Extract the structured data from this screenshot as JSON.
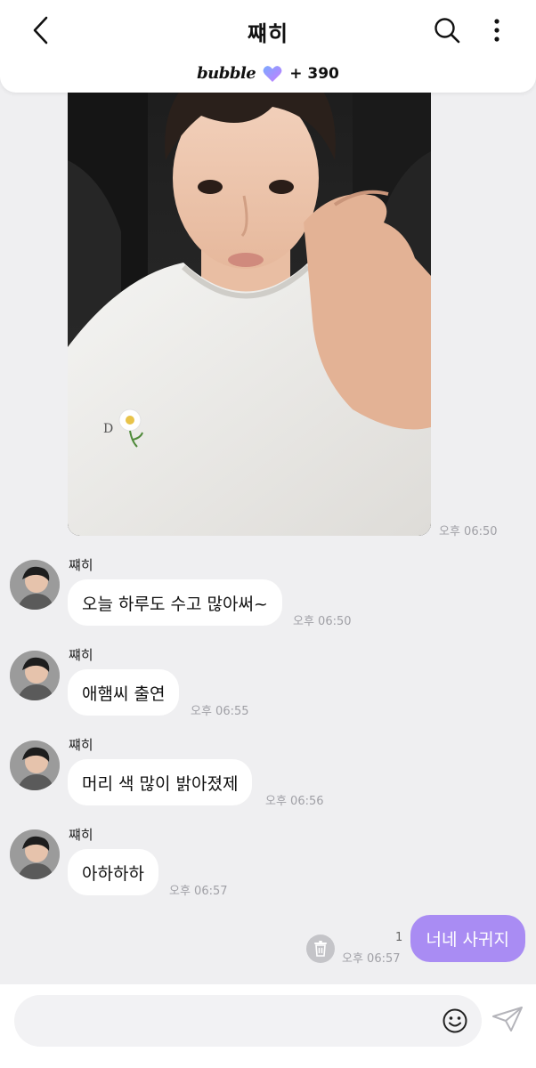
{
  "header": {
    "title": "쨰히",
    "back_icon": "chevron-left-icon",
    "search_icon": "search-icon",
    "more_icon": "more-vertical-icon",
    "bubble_logo": "bubble",
    "bubble_count": "+ 390"
  },
  "photo_message": {
    "time": "오후 06:50"
  },
  "messages": [
    {
      "sender": "쨰히",
      "text": "오늘 하루도 수고 많아써~",
      "time": "오후 06:50"
    },
    {
      "sender": "쨰히",
      "text": "애햄씨 출연",
      "time": "오후 06:55"
    },
    {
      "sender": "쨰히",
      "text": "머리 색 많이 밝아졌제",
      "time": "오후 06:56"
    },
    {
      "sender": "쨰히",
      "text": "아하하하",
      "time": "오후 06:57"
    }
  ],
  "my_message": {
    "text": "너네 사귀지",
    "time": "오후 06:57",
    "unread": "1"
  },
  "input": {
    "value": "",
    "placeholder": ""
  },
  "colors": {
    "background": "#efeff1",
    "my_bubble": "#a98cf3",
    "heart_gradient": [
      "#7aa9ff",
      "#c77dff"
    ]
  }
}
